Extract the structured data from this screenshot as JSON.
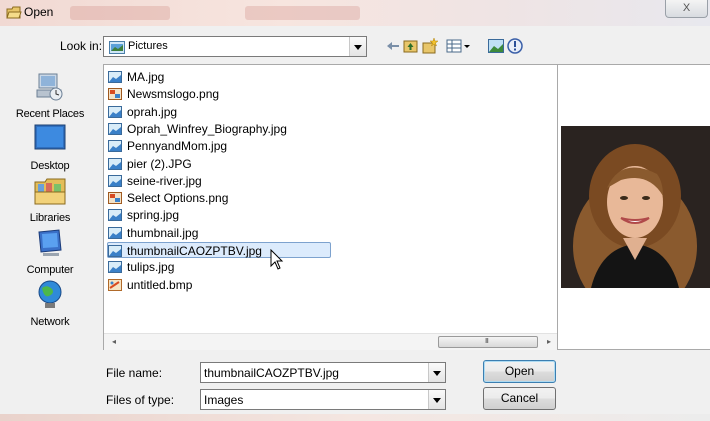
{
  "window": {
    "title": "Open",
    "close_glyph": "X"
  },
  "lookin": {
    "label": "Look in:",
    "value": "Pictures"
  },
  "toolbar": {
    "icons": [
      "back-arrow-icon",
      "up-folder-icon",
      "new-folder-icon",
      "view-menu-icon",
      "preview-toggle-icon",
      "help-icon"
    ]
  },
  "places": [
    {
      "label": "Recent Places",
      "icon": "recent-places-icon"
    },
    {
      "label": "Desktop",
      "icon": "desktop-icon"
    },
    {
      "label": "Libraries",
      "icon": "libraries-icon"
    },
    {
      "label": "Computer",
      "icon": "computer-icon"
    },
    {
      "label": "Network",
      "icon": "network-icon"
    }
  ],
  "files": [
    {
      "name": "MA.jpg",
      "type": "jpg"
    },
    {
      "name": "Newsmslogo.png",
      "type": "png"
    },
    {
      "name": "oprah.jpg",
      "type": "jpg"
    },
    {
      "name": "Oprah_Winfrey_Biography.jpg",
      "type": "jpg"
    },
    {
      "name": "PennyandMom.jpg",
      "type": "jpg"
    },
    {
      "name": "pier (2).JPG",
      "type": "jpg"
    },
    {
      "name": "seine-river.jpg",
      "type": "jpg"
    },
    {
      "name": "Select Options.png",
      "type": "png"
    },
    {
      "name": "spring.jpg",
      "type": "jpg"
    },
    {
      "name": "thumbnail.jpg",
      "type": "jpg"
    },
    {
      "name": "thumbnailCAOZPTBV.jpg",
      "type": "jpg",
      "selected": true
    },
    {
      "name": "tulips.jpg",
      "type": "jpg"
    },
    {
      "name": "untitled.bmp",
      "type": "bmp"
    }
  ],
  "scrollbar": {
    "left_glyph": "◂",
    "right_glyph": "▸",
    "grip": "III"
  },
  "filename": {
    "label": "File name:",
    "value": "thumbnailCAOZPTBV.jpg"
  },
  "filetype": {
    "label": "Files of type:",
    "value": "Images"
  },
  "buttons": {
    "open": "Open",
    "cancel": "Cancel"
  },
  "colors": {
    "selection": "#dcebfc",
    "selection_border": "#7da2ce",
    "window_bg": "#f0f0f0"
  }
}
